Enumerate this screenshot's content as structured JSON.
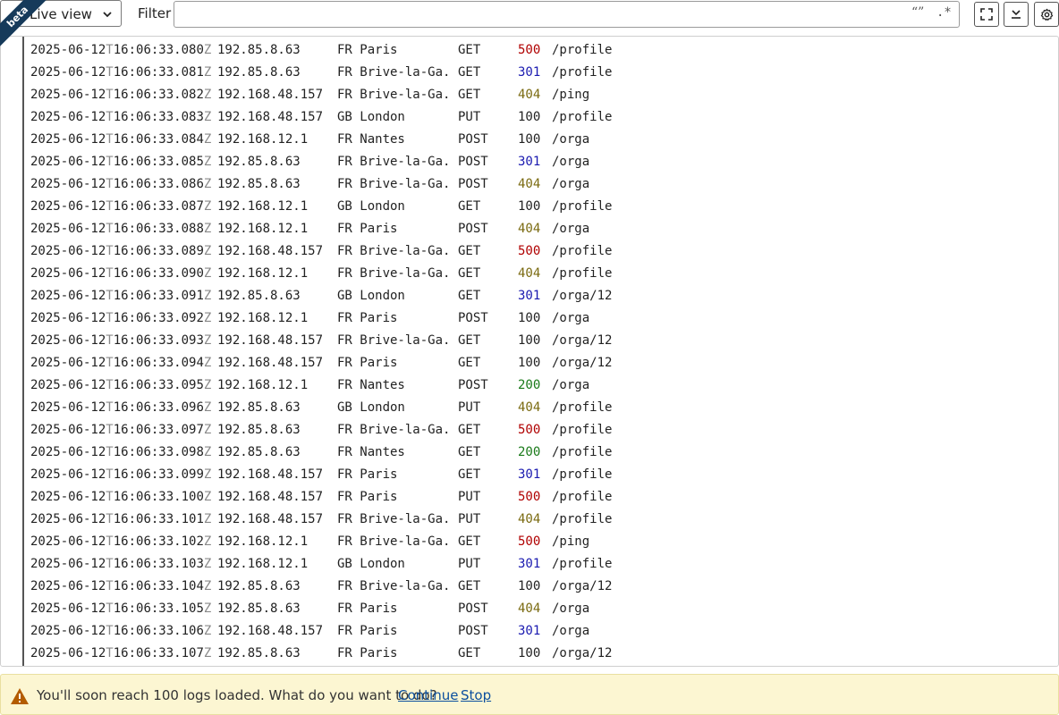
{
  "toolbar": {
    "badge": "beta",
    "view_select": "Live view",
    "filter_label": "Filter",
    "filter_value": "",
    "quote_glyph": "“”",
    "regex_glyph": ".*"
  },
  "logs": [
    {
      "date": "2025-06-12",
      "t": "T",
      "time": "16:06:33.080",
      "z": "Z",
      "ip": "192.85.8.63",
      "location": "FR Paris",
      "method": "GET",
      "status": "500",
      "path": "/profile"
    },
    {
      "date": "2025-06-12",
      "t": "T",
      "time": "16:06:33.081",
      "z": "Z",
      "ip": "192.85.8.63",
      "location": "FR Brive-la-Ga.",
      "method": "GET",
      "status": "301",
      "path": "/profile"
    },
    {
      "date": "2025-06-12",
      "t": "T",
      "time": "16:06:33.082",
      "z": "Z",
      "ip": "192.168.48.157",
      "location": "FR Brive-la-Ga.",
      "method": "GET",
      "status": "404",
      "path": "/ping"
    },
    {
      "date": "2025-06-12",
      "t": "T",
      "time": "16:06:33.083",
      "z": "Z",
      "ip": "192.168.48.157",
      "location": "GB London",
      "method": "PUT",
      "status": "100",
      "path": "/profile"
    },
    {
      "date": "2025-06-12",
      "t": "T",
      "time": "16:06:33.084",
      "z": "Z",
      "ip": "192.168.12.1",
      "location": "FR Nantes",
      "method": "POST",
      "status": "100",
      "path": "/orga"
    },
    {
      "date": "2025-06-12",
      "t": "T",
      "time": "16:06:33.085",
      "z": "Z",
      "ip": "192.85.8.63",
      "location": "FR Brive-la-Ga.",
      "method": "POST",
      "status": "301",
      "path": "/orga"
    },
    {
      "date": "2025-06-12",
      "t": "T",
      "time": "16:06:33.086",
      "z": "Z",
      "ip": "192.85.8.63",
      "location": "FR Brive-la-Ga.",
      "method": "POST",
      "status": "404",
      "path": "/orga"
    },
    {
      "date": "2025-06-12",
      "t": "T",
      "time": "16:06:33.087",
      "z": "Z",
      "ip": "192.168.12.1",
      "location": "GB London",
      "method": "GET",
      "status": "100",
      "path": "/profile"
    },
    {
      "date": "2025-06-12",
      "t": "T",
      "time": "16:06:33.088",
      "z": "Z",
      "ip": "192.168.12.1",
      "location": "FR Paris",
      "method": "POST",
      "status": "404",
      "path": "/orga"
    },
    {
      "date": "2025-06-12",
      "t": "T",
      "time": "16:06:33.089",
      "z": "Z",
      "ip": "192.168.48.157",
      "location": "FR Brive-la-Ga.",
      "method": "GET",
      "status": "500",
      "path": "/profile"
    },
    {
      "date": "2025-06-12",
      "t": "T",
      "time": "16:06:33.090",
      "z": "Z",
      "ip": "192.168.12.1",
      "location": "FR Brive-la-Ga.",
      "method": "GET",
      "status": "404",
      "path": "/profile"
    },
    {
      "date": "2025-06-12",
      "t": "T",
      "time": "16:06:33.091",
      "z": "Z",
      "ip": "192.85.8.63",
      "location": "GB London",
      "method": "GET",
      "status": "301",
      "path": "/orga/12"
    },
    {
      "date": "2025-06-12",
      "t": "T",
      "time": "16:06:33.092",
      "z": "Z",
      "ip": "192.168.12.1",
      "location": "FR Paris",
      "method": "POST",
      "status": "100",
      "path": "/orga"
    },
    {
      "date": "2025-06-12",
      "t": "T",
      "time": "16:06:33.093",
      "z": "Z",
      "ip": "192.168.48.157",
      "location": "FR Brive-la-Ga.",
      "method": "GET",
      "status": "100",
      "path": "/orga/12"
    },
    {
      "date": "2025-06-12",
      "t": "T",
      "time": "16:06:33.094",
      "z": "Z",
      "ip": "192.168.48.157",
      "location": "FR Paris",
      "method": "GET",
      "status": "100",
      "path": "/orga/12"
    },
    {
      "date": "2025-06-12",
      "t": "T",
      "time": "16:06:33.095",
      "z": "Z",
      "ip": "192.168.12.1",
      "location": "FR Nantes",
      "method": "POST",
      "status": "200",
      "path": "/orga"
    },
    {
      "date": "2025-06-12",
      "t": "T",
      "time": "16:06:33.096",
      "z": "Z",
      "ip": "192.85.8.63",
      "location": "GB London",
      "method": "PUT",
      "status": "404",
      "path": "/profile"
    },
    {
      "date": "2025-06-12",
      "t": "T",
      "time": "16:06:33.097",
      "z": "Z",
      "ip": "192.85.8.63",
      "location": "FR Brive-la-Ga.",
      "method": "GET",
      "status": "500",
      "path": "/profile"
    },
    {
      "date": "2025-06-12",
      "t": "T",
      "time": "16:06:33.098",
      "z": "Z",
      "ip": "192.85.8.63",
      "location": "FR Nantes",
      "method": "GET",
      "status": "200",
      "path": "/profile"
    },
    {
      "date": "2025-06-12",
      "t": "T",
      "time": "16:06:33.099",
      "z": "Z",
      "ip": "192.168.48.157",
      "location": "FR Paris",
      "method": "GET",
      "status": "301",
      "path": "/profile"
    },
    {
      "date": "2025-06-12",
      "t": "T",
      "time": "16:06:33.100",
      "z": "Z",
      "ip": "192.168.48.157",
      "location": "FR Paris",
      "method": "PUT",
      "status": "500",
      "path": "/profile"
    },
    {
      "date": "2025-06-12",
      "t": "T",
      "time": "16:06:33.101",
      "z": "Z",
      "ip": "192.168.48.157",
      "location": "FR Brive-la-Ga.",
      "method": "PUT",
      "status": "404",
      "path": "/profile"
    },
    {
      "date": "2025-06-12",
      "t": "T",
      "time": "16:06:33.102",
      "z": "Z",
      "ip": "192.168.12.1",
      "location": "FR Brive-la-Ga.",
      "method": "GET",
      "status": "500",
      "path": "/ping"
    },
    {
      "date": "2025-06-12",
      "t": "T",
      "time": "16:06:33.103",
      "z": "Z",
      "ip": "192.168.12.1",
      "location": "GB London",
      "method": "PUT",
      "status": "301",
      "path": "/profile"
    },
    {
      "date": "2025-06-12",
      "t": "T",
      "time": "16:06:33.104",
      "z": "Z",
      "ip": "192.85.8.63",
      "location": "FR Brive-la-Ga.",
      "method": "GET",
      "status": "100",
      "path": "/orga/12"
    },
    {
      "date": "2025-06-12",
      "t": "T",
      "time": "16:06:33.105",
      "z": "Z",
      "ip": "192.85.8.63",
      "location": "FR Paris",
      "method": "POST",
      "status": "404",
      "path": "/orga"
    },
    {
      "date": "2025-06-12",
      "t": "T",
      "time": "16:06:33.106",
      "z": "Z",
      "ip": "192.168.48.157",
      "location": "FR Paris",
      "method": "POST",
      "status": "301",
      "path": "/orga"
    },
    {
      "date": "2025-06-12",
      "t": "T",
      "time": "16:06:33.107",
      "z": "Z",
      "ip": "192.85.8.63",
      "location": "FR Paris",
      "method": "GET",
      "status": "100",
      "path": "/orga/12"
    }
  ],
  "status_colors": {
    "100": "#222222",
    "200": "#1a7a1a",
    "301": "#1a1ab0",
    "404": "#7a6a10",
    "500": "#b00000"
  },
  "warning": {
    "icon": "warning-triangle-icon",
    "message": "You'll soon reach 100 logs loaded. What do you want to do?",
    "continue_label": "Continue",
    "stop_label": "Stop"
  },
  "icons": {
    "fullscreen": "fullscreen-icon",
    "scroll_bottom": "scroll-to-bottom-icon",
    "settings": "gear-icon",
    "dropdown": "chevron-down-icon"
  }
}
